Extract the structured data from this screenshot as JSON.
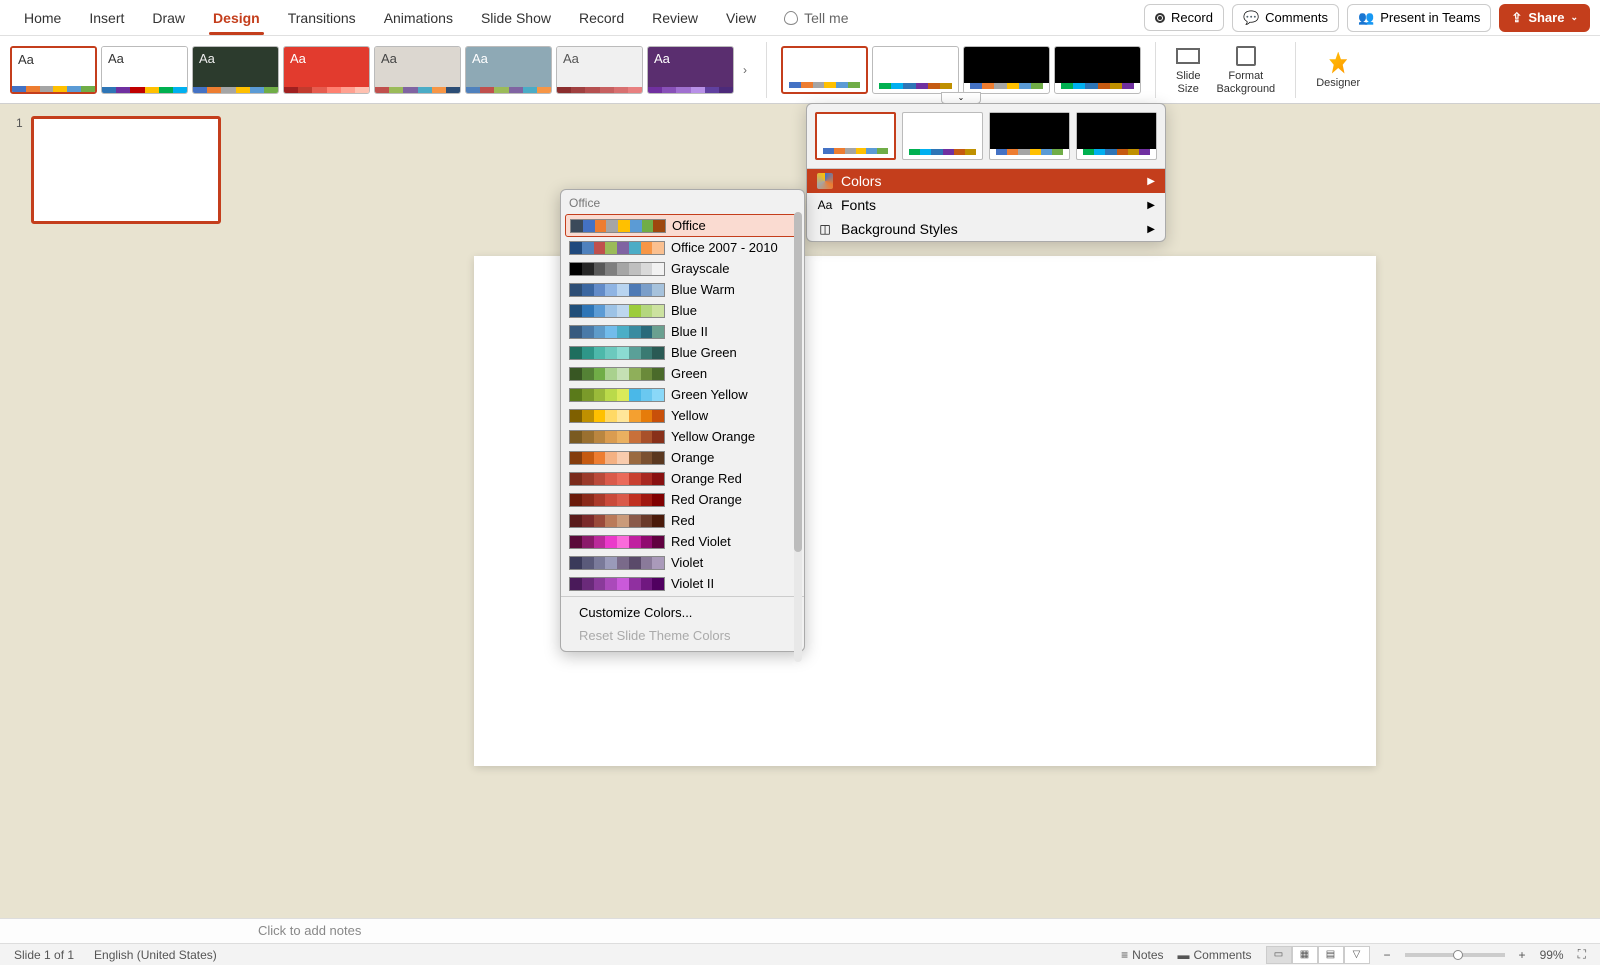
{
  "tabs": [
    "Home",
    "Insert",
    "Draw",
    "Design",
    "Transitions",
    "Animations",
    "Slide Show",
    "Record",
    "Review",
    "View"
  ],
  "active_tab_index": 3,
  "tellme": "Tell me",
  "topright": {
    "record": "Record",
    "comments": "Comments",
    "present": "Present in Teams",
    "share": "Share"
  },
  "ribbon": {
    "themes": [
      {
        "bg": "#ffffff",
        "fg": "#333",
        "strip": [
          "#4472c4",
          "#ed7d31",
          "#a5a5a5",
          "#ffc000",
          "#5b9bd5",
          "#70ad47"
        ],
        "sel": true
      },
      {
        "bg": "#ffffff",
        "fg": "#333",
        "strip": [
          "#2e75b6",
          "#7030a0",
          "#c00000",
          "#ffc000",
          "#00b050",
          "#00b0f0"
        ]
      },
      {
        "bg": "#2c3b2d",
        "fg": "#eee",
        "strip": [
          "#4472c4",
          "#ed7d31",
          "#a5a5a5",
          "#ffc000",
          "#5b9bd5",
          "#70ad47"
        ]
      },
      {
        "bg": "#e23b2e",
        "fg": "#fff",
        "strip": [
          "#a02020",
          "#c23b2e",
          "#e65c4f",
          "#ff8070",
          "#ffa090",
          "#ffc0b0"
        ]
      },
      {
        "bg": "#dcd7d0",
        "fg": "#444",
        "strip": [
          "#c0504d",
          "#9bbb59",
          "#8064a2",
          "#4bacc6",
          "#f79646",
          "#2c4d75"
        ]
      },
      {
        "bg": "#8ea9b5",
        "fg": "#fff",
        "strip": [
          "#4f81bd",
          "#c0504d",
          "#9bbb59",
          "#8064a2",
          "#4bacc6",
          "#f79646"
        ]
      },
      {
        "bg": "#f0f0f0",
        "fg": "#555",
        "strip": [
          "#8b2e2e",
          "#a04040",
          "#b55050",
          "#c76060",
          "#d87070",
          "#e88080"
        ]
      },
      {
        "bg": "#5a2e6f",
        "fg": "#fff",
        "strip": [
          "#7030a0",
          "#8850b8",
          "#a070d0",
          "#b890e8",
          "#6040a0",
          "#4c2a7a"
        ]
      }
    ],
    "variants": [
      {
        "dark": false,
        "strip": [
          "#4472c4",
          "#ed7d31",
          "#a5a5a5",
          "#ffc000",
          "#5b9bd5",
          "#70ad47"
        ],
        "sel": true
      },
      {
        "dark": false,
        "strip": [
          "#00b050",
          "#00b0f0",
          "#2e75b6",
          "#7030a0",
          "#c55a11",
          "#bf9000"
        ]
      },
      {
        "dark": true,
        "strip": [
          "#4472c4",
          "#ed7d31",
          "#a5a5a5",
          "#ffc000",
          "#5b9bd5",
          "#70ad47"
        ]
      },
      {
        "dark": true,
        "strip": [
          "#00b050",
          "#00b0f0",
          "#2e75b6",
          "#c55a11",
          "#bf9000",
          "#7030a0"
        ]
      }
    ],
    "slide_size": "Slide\nSize",
    "format_bg": "Format\nBackground",
    "designer": "Designer"
  },
  "thumb_index": "1",
  "notes_placeholder": "Click to add notes",
  "status": {
    "slide": "Slide 1 of 1",
    "lang": "English (United States)",
    "notes": "Notes",
    "comments": "Comments",
    "zoom": "99%"
  },
  "variants_popup": {
    "items": [
      "Colors",
      "Fonts",
      "Background Styles"
    ],
    "active": 0
  },
  "colors_submenu": {
    "header": "Office",
    "schemes": [
      {
        "name": "Office",
        "c": [
          "#3b4a5a",
          "#4472c4",
          "#ed7d31",
          "#a5a5a5",
          "#ffc000",
          "#5b9bd5",
          "#70ad47",
          "#9e480e"
        ],
        "sel": true
      },
      {
        "name": "Office 2007 - 2010",
        "c": [
          "#1f497d",
          "#4f81bd",
          "#c0504d",
          "#9bbb59",
          "#8064a2",
          "#4bacc6",
          "#f79646",
          "#fac090"
        ]
      },
      {
        "name": "Grayscale",
        "c": [
          "#000",
          "#262626",
          "#595959",
          "#7f7f7f",
          "#a6a6a6",
          "#bfbfbf",
          "#d9d9d9",
          "#f2f2f2"
        ]
      },
      {
        "name": "Blue Warm",
        "c": [
          "#2c4d75",
          "#3a66a0",
          "#628bc8",
          "#8fb4e3",
          "#b8d4f0",
          "#4e7ab5",
          "#7a9ec9",
          "#a6c2dc"
        ]
      },
      {
        "name": "Blue",
        "c": [
          "#1f4e79",
          "#2e75b6",
          "#5b9bd5",
          "#9dc3e6",
          "#bdd7ee",
          "#9ccc3c",
          "#b4d77e",
          "#cce2a0"
        ]
      },
      {
        "name": "Blue II",
        "c": [
          "#375a7f",
          "#4a7aa8",
          "#5e9bc9",
          "#72bceb",
          "#4baec6",
          "#3a8ba0",
          "#2a6a7a",
          "#6aa090"
        ]
      },
      {
        "name": "Blue Green",
        "c": [
          "#1f6e5e",
          "#2e9688",
          "#4db8aa",
          "#6cc9be",
          "#8bdbd2",
          "#5aa098",
          "#3a7a72",
          "#2a5a54"
        ]
      },
      {
        "name": "Green",
        "c": [
          "#385723",
          "#548235",
          "#70ad47",
          "#a9d18e",
          "#c5e0b4",
          "#8faf5a",
          "#6a8a3a",
          "#4a6a2a"
        ]
      },
      {
        "name": "Green Yellow",
        "c": [
          "#5a7a1a",
          "#7a9a2a",
          "#9aba3a",
          "#bada4a",
          "#daea5a",
          "#4ab8e8",
          "#6ac8f0",
          "#8ad8f8"
        ]
      },
      {
        "name": "Yellow",
        "c": [
          "#7f6000",
          "#bf9000",
          "#ffc000",
          "#ffd966",
          "#ffe699",
          "#f4a030",
          "#e67c0a",
          "#c8500a"
        ]
      },
      {
        "name": "Yellow Orange",
        "c": [
          "#7a5a20",
          "#9a7030",
          "#ba8640",
          "#da9c50",
          "#eab060",
          "#c8703a",
          "#a8502a",
          "#88301a"
        ]
      },
      {
        "name": "Orange",
        "c": [
          "#843c0c",
          "#c55a11",
          "#ed7d31",
          "#f4b183",
          "#f8cbad",
          "#9a6a40",
          "#7a5030",
          "#5a3820"
        ]
      },
      {
        "name": "Orange Red",
        "c": [
          "#7a2a1a",
          "#9a3a2a",
          "#ba4a3a",
          "#da5a4a",
          "#ea6a5a",
          "#c84030",
          "#a82820",
          "#881010"
        ]
      },
      {
        "name": "Red Orange",
        "c": [
          "#6a1a0a",
          "#8a2a1a",
          "#aa3a2a",
          "#ca4a3a",
          "#da5a4a",
          "#c03020",
          "#a01810",
          "#800000"
        ]
      },
      {
        "name": "Red",
        "c": [
          "#5a1a1a",
          "#7a2a2a",
          "#9a4a3a",
          "#ba7a5a",
          "#ca9a7a",
          "#8a5a4a",
          "#6a3a2a",
          "#4a1a0a"
        ]
      },
      {
        "name": "Red Violet",
        "c": [
          "#5a0a3a",
          "#8a1a6a",
          "#ba2a9a",
          "#ea3aca",
          "#fa6ada",
          "#c020a0",
          "#900a70",
          "#600040"
        ]
      },
      {
        "name": "Violet",
        "c": [
          "#3a3a5a",
          "#5a5a7a",
          "#7a7a9a",
          "#9a9aba",
          "#7a6a8a",
          "#5a4a6a",
          "#8a7a9a",
          "#aa9aba"
        ]
      },
      {
        "name": "Violet II",
        "c": [
          "#4a1a5a",
          "#6a2a7a",
          "#8a3a9a",
          "#aa4aba",
          "#ca5ada",
          "#9030a0",
          "#701880",
          "#500060"
        ]
      }
    ],
    "customize": "Customize Colors...",
    "reset": "Reset Slide Theme Colors"
  }
}
